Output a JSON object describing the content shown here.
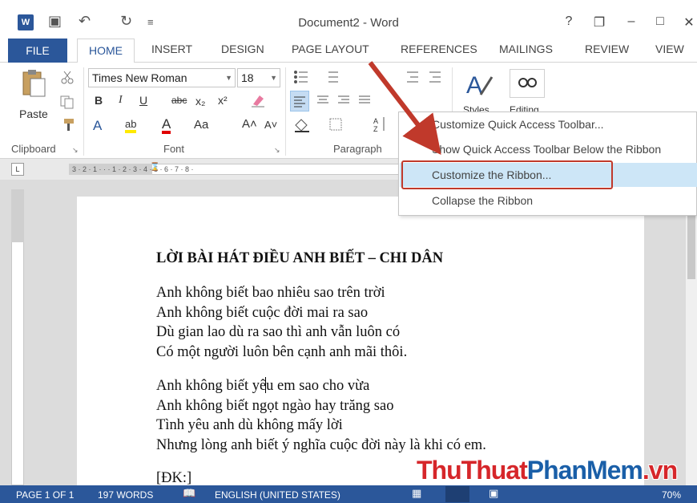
{
  "window": {
    "title": "Document2 - Word",
    "help": "?",
    "restore": "❐",
    "minimize": "–",
    "maximize": "□",
    "close": "✕",
    "app_icon": "W"
  },
  "qat": {
    "save_icon": "▣",
    "undo_icon": "↶",
    "redo_icon": "↻",
    "customize_icon": "≡"
  },
  "tabs": {
    "file": "FILE",
    "items": [
      "HOME",
      "INSERT",
      "DESIGN",
      "PAGE LAYOUT",
      "REFERENCES",
      "MAILINGS",
      "REVIEW",
      "VIEW"
    ]
  },
  "ribbon": {
    "paste": "Paste",
    "font_name": "Times New Roman",
    "font_size": "18",
    "bold": "B",
    "italic": "I",
    "underline": "U",
    "strike": "abc",
    "subscript": "x₂",
    "superscript": "x²",
    "text_effects": "A",
    "highlight": "ab",
    "font_color": "A",
    "change_case": "Aa",
    "grow": "A˄",
    "shrink": "A˅",
    "styles": "Styles",
    "editing": "Editing",
    "groups": {
      "clipboard": "Clipboard",
      "font": "Font",
      "paragraph": "Paragraph"
    }
  },
  "ruler": {
    "corner": "L",
    "marks": "3 · 2 · 1 · · · 1 · 2 · 3 · 4 · 5 · 6 · 7 · 8 ·"
  },
  "context_menu": {
    "items": [
      "Customize Quick Access Toolbar...",
      "Show Quick Access Toolbar Below the Ribbon",
      "Customize the Ribbon...",
      "Collapse the Ribbon"
    ]
  },
  "document": {
    "title": "LỜI BÀI HÁT ĐIỀU ANH BIẾT – CHI DÂN",
    "verse1": [
      "Anh không biết bao nhiêu sao trên trời",
      "Anh không biết cuộc đời mai ra sao",
      "Dù gian lao dù ra sao thì anh vẫn luôn có",
      "Có một người luôn bên cạnh anh mãi thôi."
    ],
    "verse2": [
      "Anh không biết yêu em sao cho vừa",
      "Anh không biết ngọt ngào hay trăng sao",
      "Tình yêu anh dù không mấy lời",
      "Nhưng lòng anh biết ý nghĩa cuộc đời này là khi có em."
    ],
    "chorus": "[ĐK:]"
  },
  "status": {
    "page": "PAGE 1 OF 1",
    "words": "197 WORDS",
    "language": "ENGLISH (UNITED STATES)",
    "zoom": "70%"
  },
  "watermark": {
    "part1": "Thu",
    "part2": "Thuat",
    "part3": "PhanMem",
    "part4": ".vn"
  },
  "colors": {
    "word_blue": "#2b579a",
    "highlight": "#cde6f7",
    "annotation_red": "#c0392b"
  }
}
